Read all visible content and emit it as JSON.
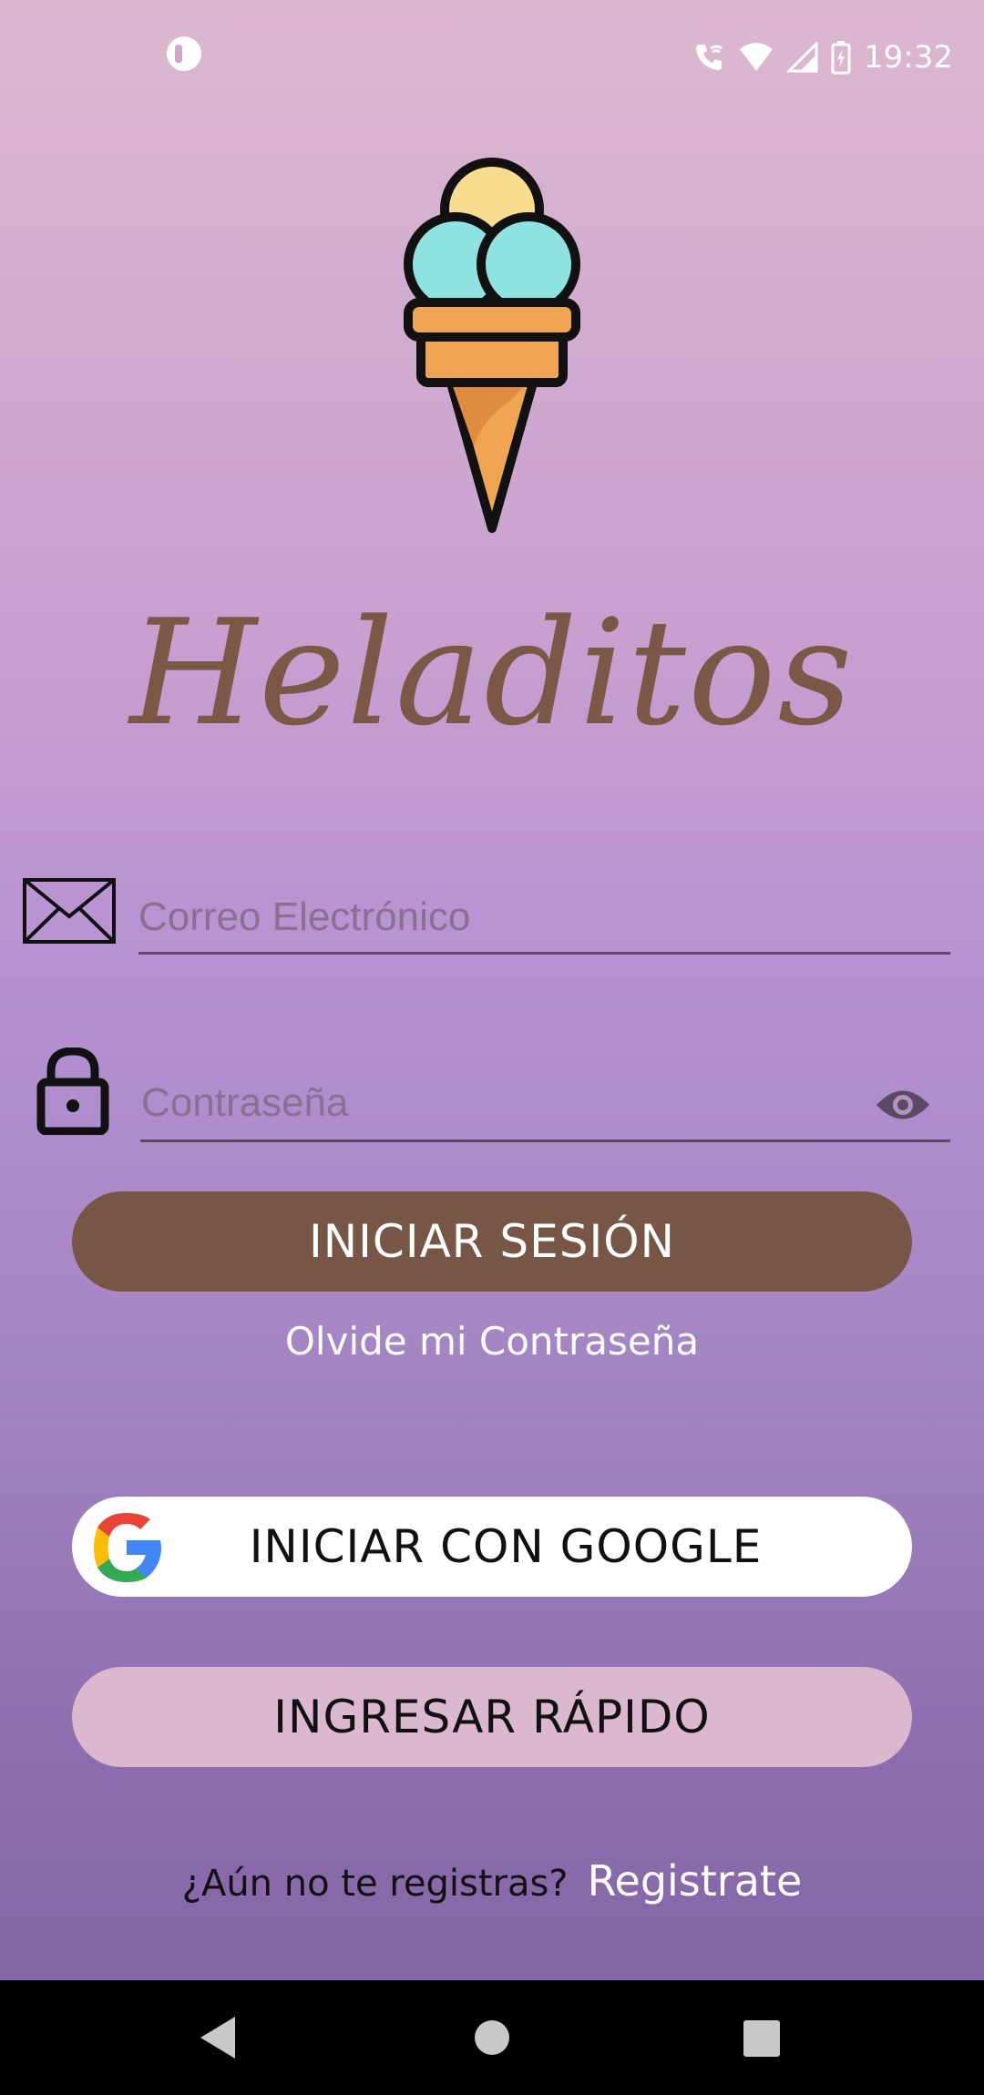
{
  "status_bar": {
    "time": "19:32",
    "icons": [
      "app-notification-icon",
      "wifi-call-icon",
      "wifi-icon",
      "signal-icon",
      "battery-charging-icon"
    ]
  },
  "app": {
    "title": "Heladitos",
    "logo_icon": "ice-cream-cone-icon",
    "colors": {
      "primary_button": "#775646",
      "title": "#7b5845",
      "quick_button": "#dcb8cf"
    }
  },
  "form": {
    "email": {
      "placeholder": "Correo Electrónico",
      "value": "",
      "icon": "envelope-icon"
    },
    "password": {
      "placeholder": "Contraseña",
      "value": "",
      "icon": "lock-icon",
      "toggle_icon": "eye-icon"
    }
  },
  "buttons": {
    "login": "INICIAR SESIÓN",
    "forgot": "Olvide mi Contraseña",
    "google": "INICIAR CON GOOGLE",
    "quick": "INGRESAR RÁPIDO"
  },
  "register": {
    "question": "¿Aún no te registras?",
    "link": "Registrate"
  },
  "nav_bar": {
    "icons": [
      "back-icon",
      "home-icon",
      "recents-icon"
    ]
  }
}
